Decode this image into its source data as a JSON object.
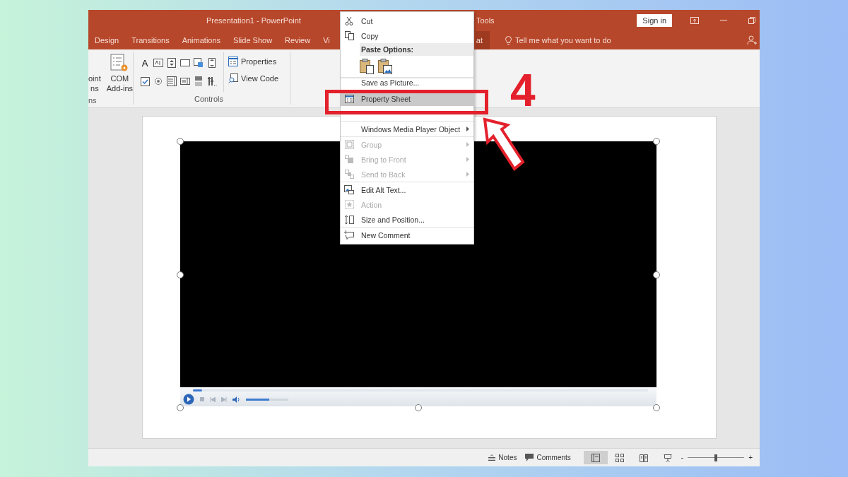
{
  "window": {
    "title": "Presentation1  -  PowerPoint",
    "contextual_tab": "Tools",
    "sign_in": "Sign in"
  },
  "ribbon_tabs": [
    {
      "label": "Design",
      "selected": false
    },
    {
      "label": "Transitions",
      "selected": false
    },
    {
      "label": "Animations",
      "selected": false
    },
    {
      "label": "Slide Show",
      "selected": false
    },
    {
      "label": "Review",
      "selected": false
    },
    {
      "label": "Vi",
      "selected": false
    },
    {
      "label": "at",
      "selected": true
    }
  ],
  "tell_me": "Tell me what you want to do",
  "ribbon": {
    "addins_group": {
      "label": "ns",
      "buttons": [
        {
          "lines": [
            "oint",
            "ns"
          ]
        },
        {
          "lines": [
            "COM",
            "Add-ins"
          ]
        }
      ]
    },
    "controls_group": {
      "label": "Controls",
      "label_glyph": "A",
      "commands": [
        "Properties",
        "View Code"
      ]
    }
  },
  "slide": {
    "media_player": {
      "seek_bar": {
        "level": 0.02
      },
      "volume": {
        "level": 0.55
      }
    }
  },
  "context_menu": [
    {
      "kind": "item",
      "label": "Cut",
      "selected": false,
      "disabled": false,
      "submenu": false
    },
    {
      "kind": "item",
      "label": "Copy",
      "selected": false,
      "disabled": false,
      "submenu": false
    },
    {
      "kind": "header",
      "label": "Paste Options:"
    },
    {
      "kind": "paste"
    },
    {
      "kind": "item",
      "label": "Save as Picture...",
      "selected": false,
      "disabled": false,
      "submenu": false
    },
    {
      "kind": "item",
      "label": "Property Sheet",
      "selected": true,
      "disabled": false,
      "submenu": false
    },
    {
      "kind": "covered"
    },
    {
      "kind": "item",
      "label": "Windows Media Player Object",
      "selected": false,
      "disabled": false,
      "submenu": true
    },
    {
      "kind": "item",
      "label": "Group",
      "selected": false,
      "disabled": true,
      "submenu": true
    },
    {
      "kind": "item",
      "label": "Bring to Front",
      "selected": false,
      "disabled": true,
      "submenu": true
    },
    {
      "kind": "item",
      "label": "Send to Back",
      "selected": false,
      "disabled": true,
      "submenu": true
    },
    {
      "kind": "item",
      "label": "Edit Alt Text...",
      "selected": false,
      "disabled": false,
      "submenu": false
    },
    {
      "kind": "item",
      "label": "Action",
      "selected": false,
      "disabled": true,
      "submenu": false
    },
    {
      "kind": "item",
      "label": "Size and Position...",
      "selected": false,
      "disabled": false,
      "submenu": false
    },
    {
      "kind": "item",
      "label": "New Comment",
      "selected": false,
      "disabled": false,
      "submenu": false
    }
  ],
  "status_bar": {
    "notes": "Notes",
    "comments": "Comments",
    "views": [
      {
        "selected": true
      },
      {
        "selected": false
      },
      {
        "selected": false
      },
      {
        "selected": false
      }
    ],
    "zoom_out": "-",
    "zoom_in": "+",
    "zoom": {
      "level": 0.5
    }
  },
  "annotation": {
    "step": "4"
  }
}
